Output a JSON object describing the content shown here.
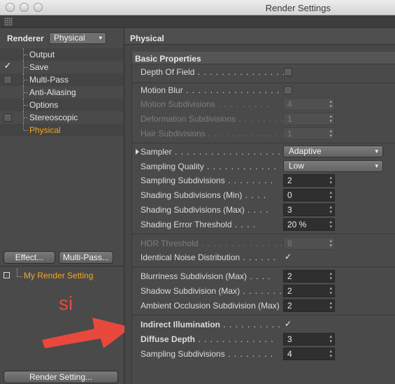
{
  "window": {
    "title": "Render Settings"
  },
  "left": {
    "renderer_label": "Renderer",
    "renderer_value": "Physical",
    "tree": [
      {
        "label": "Output",
        "check": "none",
        "active": false
      },
      {
        "label": "Save",
        "check": "checked",
        "active": false
      },
      {
        "label": "Multi-Pass",
        "check": "empty",
        "active": false
      },
      {
        "label": "Anti-Aliasing",
        "check": "none",
        "active": false
      },
      {
        "label": "Options",
        "check": "none",
        "active": false
      },
      {
        "label": "Stereoscopic",
        "check": "empty",
        "active": false
      },
      {
        "label": "Physical",
        "check": "none",
        "active": true
      }
    ],
    "effect_button": "Effect...",
    "multipass_button": "Multi-Pass...",
    "render_setting_name": "My Render Setting",
    "render_setting_button": "Render Setting..."
  },
  "annotation": {
    "text": "si",
    "color": "#e8493c"
  },
  "right": {
    "title": "Physical",
    "section": "Basic Properties",
    "props": {
      "dof": {
        "label": "Depth Of Field",
        "checked": false
      },
      "motion_blur": {
        "label": "Motion Blur",
        "checked": false
      },
      "motion_subdiv": {
        "label": "Motion Subdivisions",
        "value": "4"
      },
      "deform_subdiv": {
        "label": "Deformation Subdivisions",
        "value": "1"
      },
      "hair_subdiv": {
        "label": "Hair Subdivisions",
        "value": "1"
      },
      "sampler": {
        "label": "Sampler",
        "value": "Adaptive"
      },
      "sampling_quality": {
        "label": "Sampling Quality",
        "value": "Low"
      },
      "sampling_subdiv": {
        "label": "Sampling Subdivisions",
        "value": "2"
      },
      "shading_min": {
        "label": "Shading Subdivisions (Min)",
        "value": "0"
      },
      "shading_max": {
        "label": "Shading Subdivisions (Max)",
        "value": "3"
      },
      "shading_err": {
        "label": "Shading Error Threshold",
        "value": "20 %"
      },
      "hdr": {
        "label": "HDR Threshold",
        "value": "8"
      },
      "noise": {
        "label": "Identical Noise Distribution",
        "checked": true
      },
      "blur_subdiv": {
        "label": "Blurriness Subdivision (Max)",
        "value": "2"
      },
      "shadow_subdiv": {
        "label": "Shadow Subdivision (Max)",
        "value": "2"
      },
      "ao_subdiv": {
        "label": "Ambient Occlusion Subdivision (Max)",
        "value": "2"
      },
      "indirect": {
        "label": "Indirect Illumination",
        "checked": true
      },
      "diffuse_depth": {
        "label": "Diffuse Depth",
        "value": "3"
      },
      "gi_sampling_subdiv": {
        "label": "Sampling Subdivisions",
        "value": "4"
      }
    }
  },
  "icons": {
    "checked": "✓",
    "dropdown": "▾",
    "spinner": "▴▾"
  }
}
